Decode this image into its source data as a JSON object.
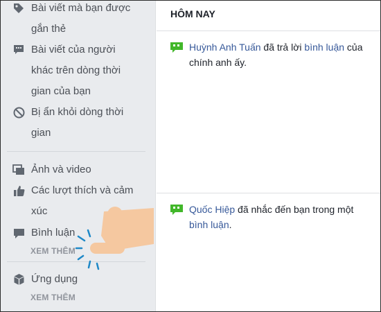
{
  "sidebar": {
    "items": [
      {
        "icon": "tag-icon",
        "lines": [
          "Bài viết mà bạn được",
          "gắn thẻ"
        ]
      },
      {
        "icon": "comment-bubble-icon",
        "lines": [
          "Bài viết của người",
          "khác trên dòng thời",
          "gian của bạn"
        ]
      },
      {
        "icon": "hidden-circle-icon",
        "lines": [
          "Bị ẩn khỏi dòng thời",
          "gian"
        ]
      },
      {
        "icon": "photos-icon",
        "lines": [
          "Ảnh và video"
        ]
      },
      {
        "icon": "thumbs-up-icon",
        "lines": [
          "Các lượt thích và cảm",
          "xúc"
        ]
      },
      {
        "icon": "comment-icon",
        "lines": [
          "Bình luận"
        ],
        "see_more": "XEM THÊM"
      },
      {
        "icon": "cube-icon",
        "lines": [
          "Ứng dụng"
        ],
        "see_more": "XEM THÊM"
      }
    ]
  },
  "main": {
    "header": "HÔM NAY",
    "notifications": [
      {
        "icon": "quote-bubble-icon",
        "actor": "Huỳnh Anh Tuấn",
        "pre": " đã trả lời ",
        "link": "bình luận",
        "post": " của",
        "line2": "chính anh ấy."
      },
      {
        "icon": "quote-bubble-icon",
        "actor": "Quốc Hiệp",
        "pre": " đã nhắc đến bạn trong một",
        "line2_link": "bình luận",
        "line2_post": "."
      }
    ]
  },
  "colors": {
    "sidebar_bg": "#e9ebee",
    "link": "#365899",
    "text": "#1d2129",
    "muted": "#90949c",
    "notif_icon": "#42b72a",
    "hand": "#f5c8a0",
    "tap_lines": "#1e88c7"
  }
}
